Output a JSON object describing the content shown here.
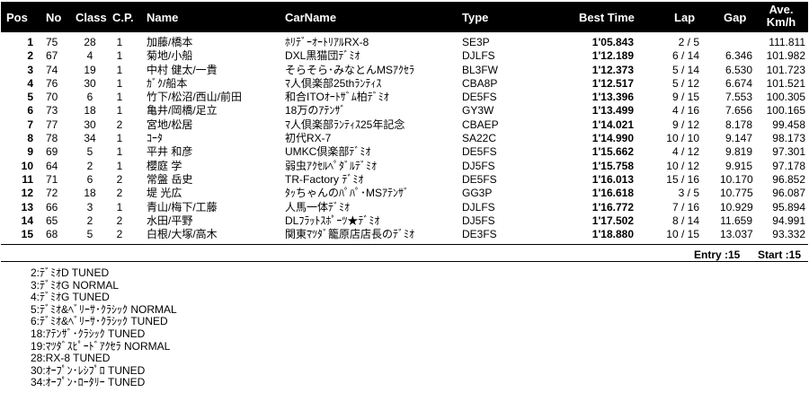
{
  "columns": {
    "pos": "Pos",
    "no": "No",
    "class": "Class",
    "cp": "C.P.",
    "name": "Name",
    "carname": "CarName",
    "type": "Type",
    "best_time": "Best Time",
    "lap": "Lap",
    "gap": "Gap",
    "ave_line1": "Ave.",
    "ave_line2": "Km/h"
  },
  "results": [
    {
      "pos": "1",
      "no": "75",
      "class": "28",
      "cp": "1",
      "name": "加藤/橋本",
      "car": "ﾎﾘﾃﾞｰｵｰﾄﾘｱﾙRX-8",
      "type": "SE3P",
      "best": "1'05.843",
      "lap": "2 / 5",
      "gap": "",
      "ave": "111.811"
    },
    {
      "pos": "2",
      "no": "67",
      "class": "4",
      "cp": "1",
      "name": "菊地/小船",
      "car": "DXL黒猫団ﾃﾞﾐｵ",
      "type": "DJLFS",
      "best": "1'12.189",
      "lap": "6 / 14",
      "gap": "6.346",
      "ave": "101.982"
    },
    {
      "pos": "3",
      "no": "74",
      "class": "19",
      "cp": "1",
      "name": "中村 健太/一貴",
      "car": "そらそら･みなとんMSｱｸｾﾗ",
      "type": "BL3FW",
      "best": "1'12.373",
      "lap": "5 / 14",
      "gap": "6.530",
      "ave": "101.723"
    },
    {
      "pos": "4",
      "no": "76",
      "class": "30",
      "cp": "1",
      "name": "ｶﾞｸ/船本",
      "car": "ﾏ人倶楽部25thﾗﾝﾃｨｽ",
      "type": "CBA8P",
      "best": "1'12.517",
      "lap": "5 / 12",
      "gap": "6.674",
      "ave": "101.521"
    },
    {
      "pos": "5",
      "no": "70",
      "class": "6",
      "cp": "1",
      "name": "竹下/松沼/西山/前田",
      "car": "和合ITOｵｰﾄｻﾞﾑ柏ﾃﾞﾐｵ",
      "type": "DE5FS",
      "best": "1'13.396",
      "lap": "9 / 15",
      "gap": "7.553",
      "ave": "100.305"
    },
    {
      "pos": "6",
      "no": "73",
      "class": "18",
      "cp": "1",
      "name": "亀井/岡橋/足立",
      "car": "18万のｱﾃﾝｻﾞ",
      "type": "GY3W",
      "best": "1'13.499",
      "lap": "4 / 16",
      "gap": "7.656",
      "ave": "100.165"
    },
    {
      "pos": "7",
      "no": "77",
      "class": "30",
      "cp": "2",
      "name": "宮地/松居",
      "car": "ﾏ人倶楽部ﾗﾝﾃｨｽ25年記念",
      "type": "CBAEP",
      "best": "1'14.021",
      "lap": "9 / 12",
      "gap": "8.178",
      "ave": "99.458"
    },
    {
      "pos": "8",
      "no": "78",
      "class": "34",
      "cp": "1",
      "name": "ｺｰﾀ",
      "car": "初代RX-7",
      "type": "SA22C",
      "best": "1'14.990",
      "lap": "10 / 10",
      "gap": "9.147",
      "ave": "98.173"
    },
    {
      "pos": "9",
      "no": "69",
      "class": "5",
      "cp": "1",
      "name": "平井 和彦",
      "car": "UMKC倶楽部ﾃﾞﾐｵ",
      "type": "DE5FS",
      "best": "1'15.662",
      "lap": "4 / 12",
      "gap": "9.819",
      "ave": "97.301"
    },
    {
      "pos": "10",
      "no": "64",
      "class": "2",
      "cp": "1",
      "name": "櫻庭 学",
      "car": "弱虫ｱｸｾﾙﾍﾟﾀﾞﾙﾃﾞﾐｵ",
      "type": "DJ5FS",
      "best": "1'15.758",
      "lap": "10 / 12",
      "gap": "9.915",
      "ave": "97.178"
    },
    {
      "pos": "11",
      "no": "71",
      "class": "6",
      "cp": "2",
      "name": "常盤 岳史",
      "car": "TR-Factory ﾃﾞﾐｵ",
      "type": "DE5FS",
      "best": "1'16.013",
      "lap": "15 / 16",
      "gap": "10.170",
      "ave": "96.852"
    },
    {
      "pos": "12",
      "no": "72",
      "class": "18",
      "cp": "2",
      "name": "堤 光広",
      "car": "ﾀｯちゃんのﾊﾟﾊﾟ･MSｱﾃﾝｻﾞ",
      "type": "GG3P",
      "best": "1'16.618",
      "lap": "3 / 5",
      "gap": "10.775",
      "ave": "96.087"
    },
    {
      "pos": "13",
      "no": "66",
      "class": "3",
      "cp": "1",
      "name": "青山/梅下/工藤",
      "car": "人馬一体ﾃﾞﾐｵ",
      "type": "DJLFS",
      "best": "1'16.772",
      "lap": "7 / 16",
      "gap": "10.929",
      "ave": "95.894"
    },
    {
      "pos": "14",
      "no": "65",
      "class": "2",
      "cp": "2",
      "name": "水田/平野",
      "car": "DLﾌﾗｯﾄｽﾎﾟｰﾂ★ﾃﾞﾐｵ",
      "type": "DJ5FS",
      "best": "1'17.502",
      "lap": "8 / 14",
      "gap": "11.659",
      "ave": "94.991"
    },
    {
      "pos": "15",
      "no": "68",
      "class": "5",
      "cp": "2",
      "name": "白根/大塚/高木",
      "car": "関東ﾏﾂﾀﾞ籠原店店長のﾃﾞﾐｵ",
      "type": "DE3FS",
      "best": "1'18.880",
      "lap": "10 / 15",
      "gap": "13.037",
      "ave": "93.332"
    }
  ],
  "summary": {
    "entry": "Entry :15",
    "start": "Start :15"
  },
  "class_legend": [
    "2:ﾃﾞﾐｵD TUNED",
    "3:ﾃﾞﾐｵG NORMAL",
    "4:ﾃﾞﾐｵG TUNED",
    "5:ﾃﾞﾐｵ&ﾍﾞﾘｰｻ･ｸﾗｼｯｸ NORMAL",
    "6:ﾃﾞﾐｵ&ﾍﾞﾘｰｻ･ｸﾗｼｯｸ TUNED",
    "18:ｱﾃﾝｻﾞ･ｸﾗｼｯｸ TUNED",
    "19:ﾏﾂﾀﾞｽﾋﾟｰﾄﾞｱｸｾﾗ NORMAL",
    "28:RX-8 TUNED",
    "30:ｵｰﾌﾟﾝ･ﾚｼﾌﾟﾛ TUNED",
    "34:ｵｰﾌﾟﾝ･ﾛｰﾀﾘｰ TUNED"
  ],
  "colors": {
    "header_bg": "#000000",
    "header_text": "#ffffff",
    "text": "#000000"
  }
}
